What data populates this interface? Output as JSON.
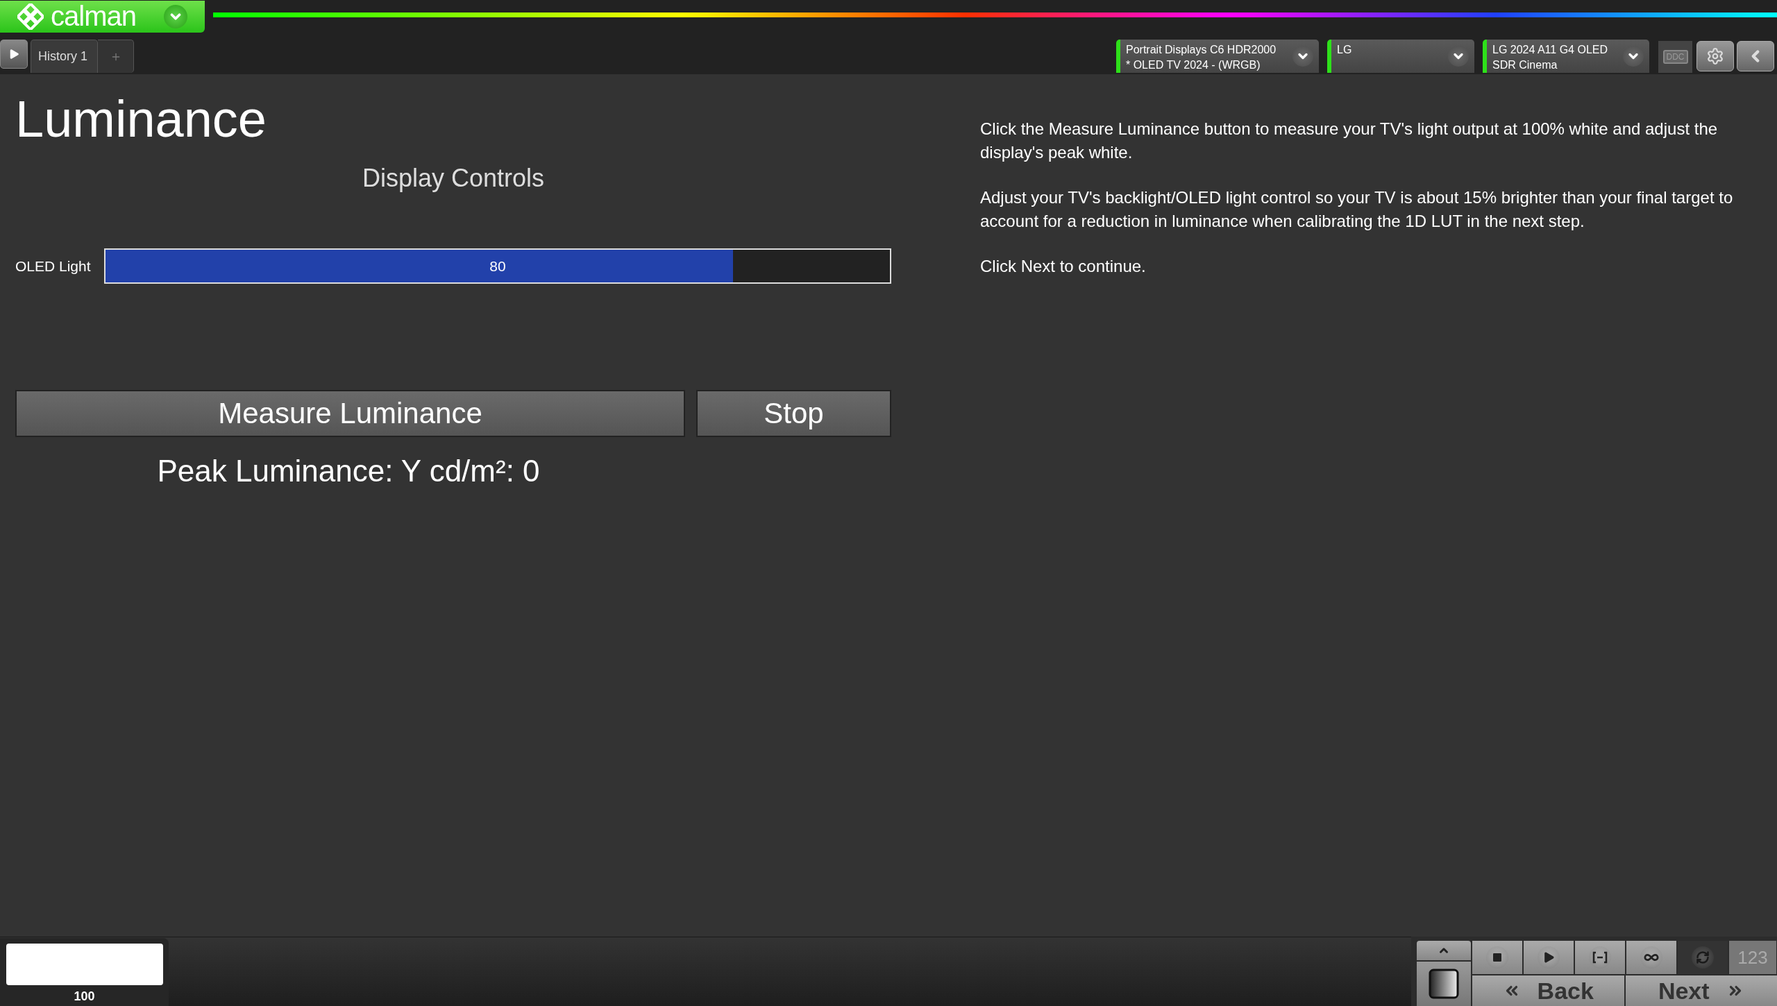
{
  "app": {
    "logo": "calman"
  },
  "history_tabs": [
    {
      "label": "History 1",
      "selected": true
    }
  ],
  "device_selectors": [
    {
      "line_1": "Portrait Displays C6 HDR2000",
      "line_2": "* OLED TV 2024 - (WRGB)",
      "connected": true
    },
    {
      "line_1": "LG",
      "connected": true
    },
    {
      "line_1": "LG 2024 A11 G4 OLED",
      "line_2": "SDR Cinema",
      "connected": true
    }
  ],
  "ddc_label": "DDC",
  "page": {
    "title": "Luminance",
    "section_title": "Display Controls",
    "controls": [
      {
        "label": "OLED Light",
        "reading": "80",
        "level": 0.8
      }
    ],
    "buttons": [
      "Measure Luminance",
      "Stop"
    ],
    "result": "Peak Luminance: Y cd/m²: 0",
    "instructions": [
      "Click the Measure Luminance button to measure your TV's light output at 100% white and adjust the display's peak white.",
      "Adjust your TV's backlight/OLED light control so your TV is about 15% brighter than your final target to account for a reduction in luminance when calibrating the 1D LUT in the next step.",
      "Click Next to continue."
    ]
  },
  "footer": {
    "pattern_label": "100",
    "transport_buttons": [
      {
        "kind": "stop",
        "disabled": false
      },
      {
        "kind": "play",
        "disabled": false
      },
      {
        "kind": "range",
        "disabled": false
      },
      {
        "kind": "loop",
        "disabled": false
      },
      {
        "kind": "sync",
        "disabled": true
      }
    ],
    "counter": "123",
    "back": "Back",
    "next": "Next"
  }
}
